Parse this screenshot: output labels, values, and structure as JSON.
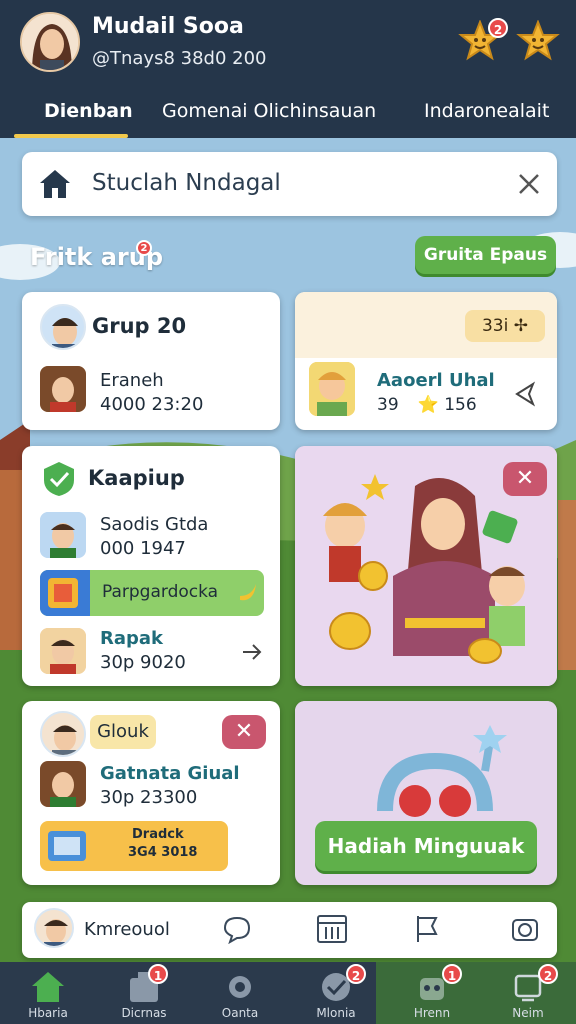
{
  "header": {
    "user_name": "Mudail Sooa",
    "user_handle": "@Tnays8 38d0 200",
    "notification_count": "2"
  },
  "tabs": [
    {
      "label": "Dienban"
    },
    {
      "label": "Gomenai Olichinsauan"
    },
    {
      "label": "Indaronealait"
    }
  ],
  "search": {
    "value": "Stuclah Nndagal"
  },
  "section": {
    "title": "Fritk arup",
    "badge": "2",
    "action_label": "Gruita Epaus"
  },
  "cards": {
    "group": {
      "title": "Grup 20",
      "member_name": "Eraneh",
      "member_meta": "4000 23:20"
    },
    "reward_top": {
      "pill": "33i ✢",
      "name": "Aaoerl Uhal",
      "meta": "39 ⭐ 156"
    },
    "kaapiup": {
      "title": "Kaapiup",
      "row1_name": "Saodis Gtda",
      "row1_meta": "000 1947",
      "highlight": "Parpgardocka",
      "row2_name": "Rapak",
      "row2_meta": "30p 9020"
    },
    "glouk": {
      "tag": "Glouk",
      "name": "Gatnata Giual",
      "meta": "30p 23300",
      "box_line1": "Dradck",
      "box_line2": "3G4 3018"
    },
    "promo_button": "Hadiah Minguuak"
  },
  "bottom_strip": {
    "label": "Kmreouol"
  },
  "nav": [
    {
      "label": "Hbaria",
      "badge": ""
    },
    {
      "label": "Dicrnas",
      "badge": "1"
    },
    {
      "label": "Oanta",
      "badge": ""
    },
    {
      "label": "Mlonia",
      "badge": "2"
    },
    {
      "label": "Hrenn",
      "badge": "1"
    },
    {
      "label": "Neim",
      "badge": "2"
    }
  ],
  "colors": {
    "header": "#25364a",
    "accent_green": "#5fb04a",
    "close_red": "#c9566e",
    "tab_underline": "#f2c94c"
  }
}
